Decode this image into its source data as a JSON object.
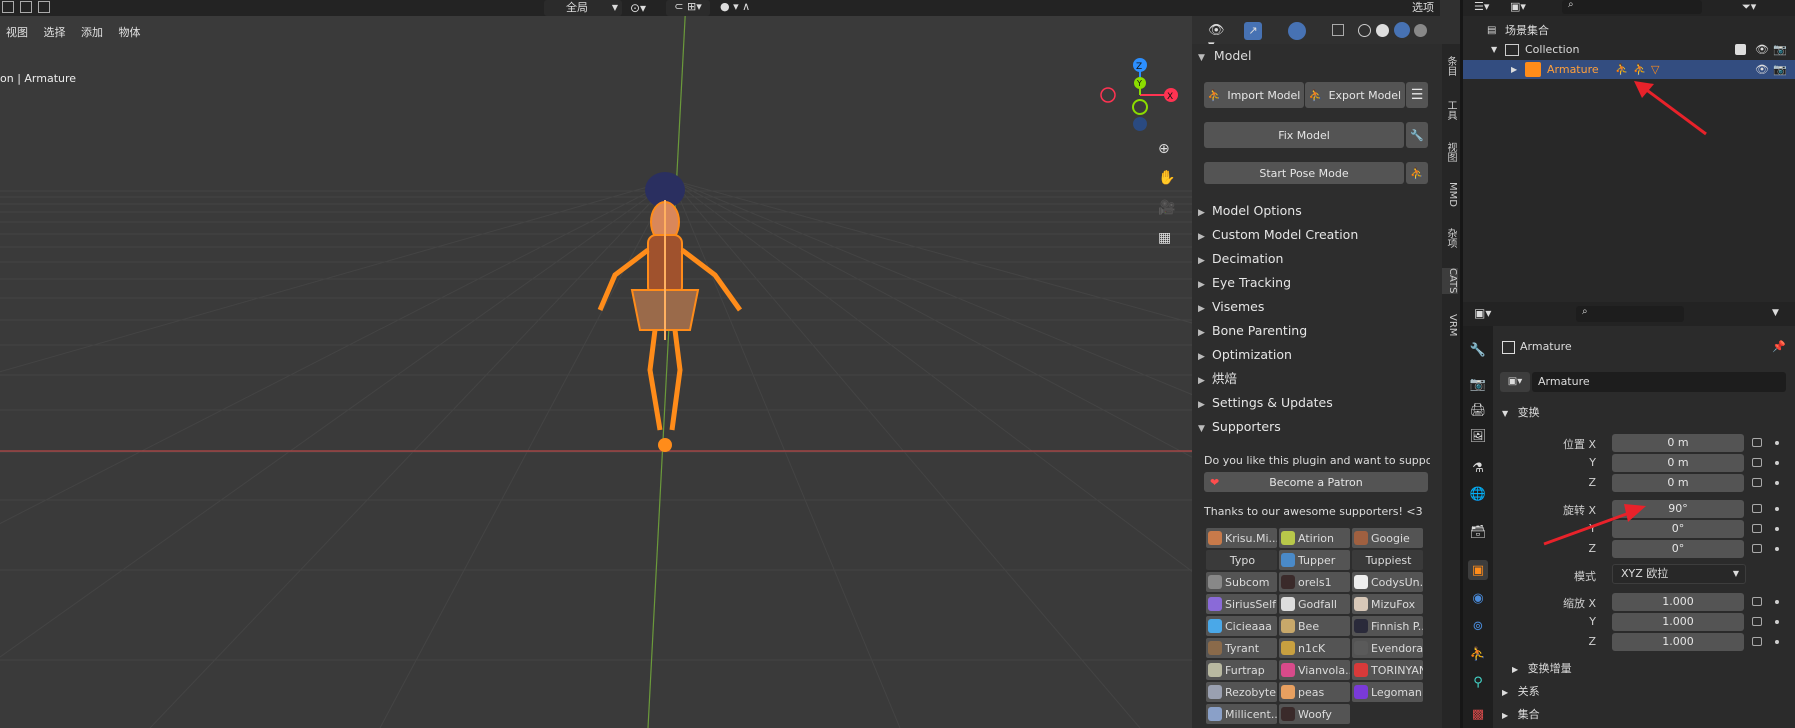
{
  "viewport": {
    "menu": [
      "视图",
      "选择",
      "添加",
      "物体"
    ],
    "transform_orientation": "全局",
    "overlay_label": "on | Armature",
    "options_label": "选项"
  },
  "cats_panel": {
    "model_section": "Model",
    "import_model": "Import Model",
    "export_model": "Export Model",
    "fix_model": "Fix Model",
    "start_pose_mode": "Start Pose Mode",
    "sections": [
      "Model Options",
      "Custom Model Creation",
      "Decimation",
      "Eye Tracking",
      "Visemes",
      "Bone Parenting",
      "Optimization",
      "烘焙",
      "Settings & Updates"
    ],
    "supporters_section": "Supporters",
    "support_question": "Do you like this plugin and want to support ...",
    "become_patron": "Become a Patron",
    "thanks_text": "Thanks to our awesome supporters! <3",
    "supporters": [
      "Krisu.Mi...",
      "Atirion",
      "Googie",
      "Typo",
      "Tupper",
      "Tuppiest",
      "Subcom",
      "orels1",
      "CodysUn...",
      "SiriusSelf",
      "Godfall",
      "MizuFox",
      "Cicieaaa",
      "Bee",
      "Finnish P...",
      "Tyrant",
      "n1cK",
      "Evendora",
      "Furtrap",
      "Vianvola...",
      "TORINYAN",
      "Rezobyte",
      "peas",
      "Legoman...",
      "Millicent...",
      "Woofy"
    ]
  },
  "sidebar_tabs": [
    "条目",
    "工具",
    "视图",
    "MMD",
    "杂项",
    "CATS",
    "VRM"
  ],
  "outliner": {
    "scene_collection": "场景集合",
    "collection": "Collection",
    "armature": "Armature"
  },
  "properties": {
    "object_name": "Armature",
    "name_field": "Armature",
    "transform_section": "变换",
    "location_label": "位置 X",
    "rotation_label": "旋转 X",
    "scale_label": "缩放 X",
    "axis_y": "Y",
    "axis_z": "Z",
    "location": [
      "0 m",
      "0 m",
      "0 m"
    ],
    "rotation": [
      "90°",
      "0°",
      "0°"
    ],
    "mode_label": "模式",
    "mode_value": "XYZ 欧拉",
    "scale": [
      "1.000",
      "1.000",
      "1.000"
    ],
    "delta_transform": "变换增量",
    "relations": "关系",
    "collections": "集合"
  },
  "colors": {
    "selection": "#334d80",
    "armature_orange": "#ff8c1a",
    "arrow_red": "#e8222a"
  }
}
